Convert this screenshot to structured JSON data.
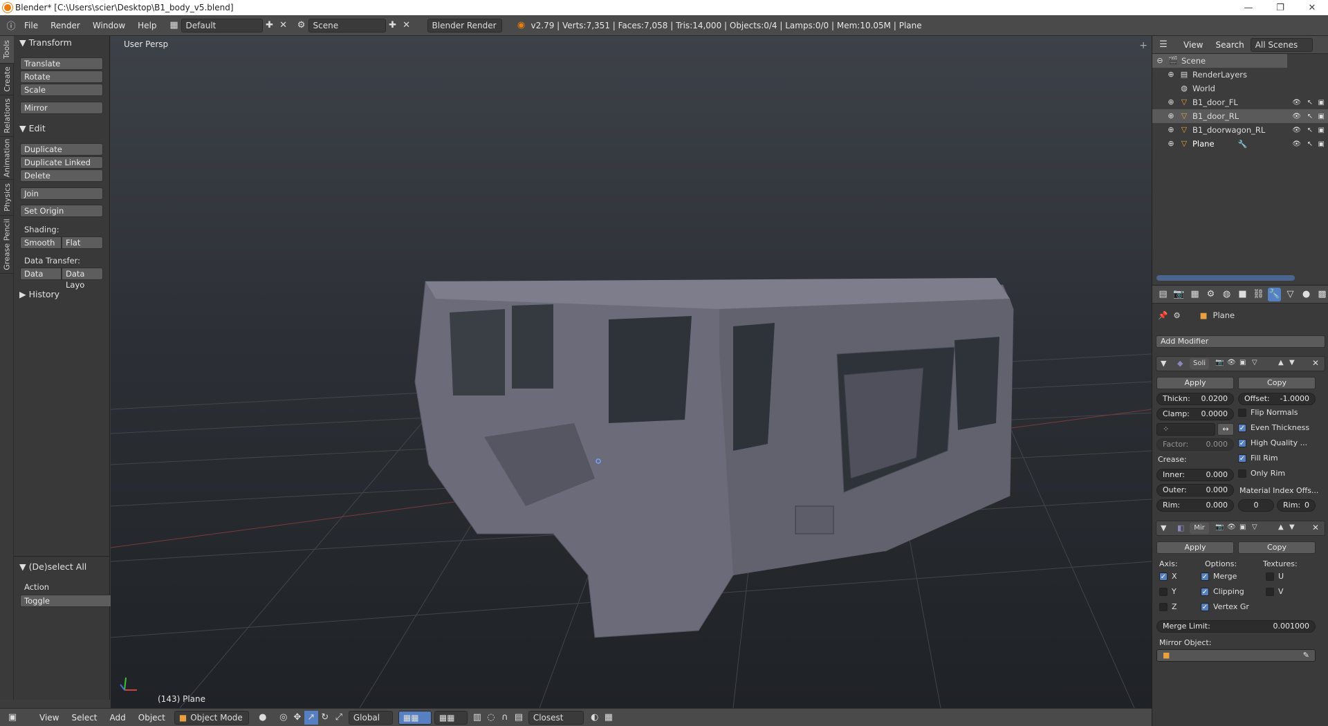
{
  "window": {
    "title": "Blender* [C:\\Users\\scier\\Desktop\\B1_body_v5.blend]",
    "minimize": "—",
    "maximize": "❐",
    "close": "✕"
  },
  "info_header": {
    "menus": [
      "File",
      "Render",
      "Window",
      "Help"
    ],
    "screen_layout": "Default",
    "scene": "Scene",
    "engine": "Blender Render",
    "stats": "v2.79 | Verts:7,351 | Faces:7,058 | Tris:14,000 | Objects:0/4 | Lamps:0/0 | Mem:10.05M | Plane"
  },
  "tool_tabs": [
    "Tools",
    "Create",
    "Relations",
    "Animation",
    "Physics",
    "Grease Pencil"
  ],
  "tool_shelf": {
    "transform_header": "Transform",
    "translate": "Translate",
    "rotate": "Rotate",
    "scale": "Scale",
    "mirror": "Mirror",
    "edit_header": "Edit",
    "duplicate": "Duplicate",
    "duplicate_linked": "Duplicate Linked",
    "delete": "Delete",
    "join": "Join",
    "set_origin": "Set Origin",
    "shading_label": "Shading:",
    "smooth": "Smooth",
    "flat": "Flat",
    "data_transfer_label": "Data Transfer:",
    "data": "Data",
    "data_layout": "Data Layo",
    "history_header": "History"
  },
  "operator_panel": {
    "header": "(De)select All",
    "action_label": "Action",
    "action_value": "Toggle"
  },
  "viewport": {
    "view_name": "User Persp",
    "object_info": "(143) Plane"
  },
  "view3d_header": {
    "menus": [
      "View",
      "Select",
      "Add",
      "Object"
    ],
    "mode": "Object Mode",
    "orientation": "Global",
    "snap_target": "Closest"
  },
  "outliner": {
    "menus": [
      "View",
      "Search"
    ],
    "filter": "All Scenes",
    "items": [
      {
        "name": "Scene",
        "icon": "scene-icon"
      },
      {
        "name": "RenderLayers",
        "icon": "renderlayers-icon"
      },
      {
        "name": "World",
        "icon": "world-icon"
      },
      {
        "name": "B1_door_FL",
        "icon": "mesh-icon"
      },
      {
        "name": "B1_door_RL",
        "icon": "mesh-icon"
      },
      {
        "name": "B1_doorwagon_RL",
        "icon": "mesh-icon"
      },
      {
        "name": "Plane",
        "icon": "mesh-icon"
      }
    ]
  },
  "properties": {
    "object_name": "Plane",
    "add_modifier": "Add Modifier",
    "solidify": {
      "name": "Soli",
      "apply": "Apply",
      "copy": "Copy",
      "thickness_label": "Thickn:",
      "thickness": "0.0200",
      "offset_label": "Offset:",
      "offset": "-1.0000",
      "clamp_label": "Clamp:",
      "clamp": "0.0000",
      "flip_normals": "Flip Normals",
      "even_thickness": "Even Thickness",
      "high_quality": "High Quality ...",
      "fill_rim": "Fill Rim",
      "only_rim": "Only Rim",
      "factor_label": "Factor:",
      "factor": "0.000",
      "crease_label": "Crease:",
      "inner_label": "Inner:",
      "inner": "0.000",
      "outer_label": "Outer:",
      "outer": "0.000",
      "rim_label": "Rim:",
      "rim": "0.000",
      "material_label": "Material Index Offs...",
      "material_offset": "0",
      "material_rim_label": "Rim:",
      "material_rim": "0"
    },
    "mirror": {
      "name": "Mir",
      "apply": "Apply",
      "copy": "Copy",
      "axis_label": "Axis:",
      "options_label": "Options:",
      "textures_label": "Textures:",
      "x": "X",
      "y": "Y",
      "z": "Z",
      "merge": "Merge",
      "clipping": "Clipping",
      "vertex_groups": "Vertex Gr",
      "u": "U",
      "v": "V",
      "merge_limit_label": "Merge Limit:",
      "merge_limit": "0.001000",
      "mirror_object_label": "Mirror Object:"
    }
  },
  "colors": {
    "accent_orange": "#e87d0d",
    "checkbox_blue": "#5680c2"
  }
}
